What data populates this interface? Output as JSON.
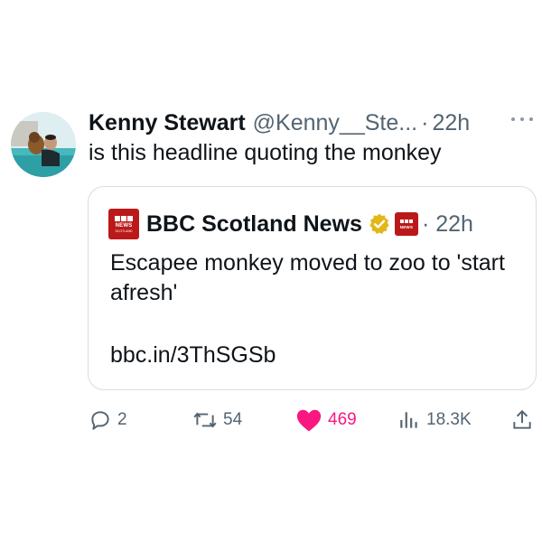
{
  "tweet": {
    "author_name": "Kenny Stewart",
    "author_handle": "@Kenny__Ste...",
    "separator": "·",
    "time": "22h",
    "text": "is this headline quoting the monkey"
  },
  "quoted_tweet": {
    "account_name": "BBC Scotland News",
    "time": "· 22h",
    "text": "Escapee monkey moved to zoo to 'start afresh'",
    "link": "bbc.in/3ThSGSb",
    "logo_text": "NEWS",
    "logo_subtext": "SCOTLAND",
    "brand_color": "#bb1919",
    "verified_color": "#e2b719"
  },
  "actions": {
    "replies": "2",
    "retweets": "54",
    "likes": "469",
    "views": "18.3K"
  },
  "colors": {
    "text": "#0f1419",
    "muted": "#536471",
    "like": "#f91880",
    "border": "#d6dde2"
  },
  "icons": [
    "more-icon",
    "reply-icon",
    "retweet-icon",
    "heart-icon",
    "views-icon",
    "share-icon",
    "verified-badge-icon"
  ]
}
